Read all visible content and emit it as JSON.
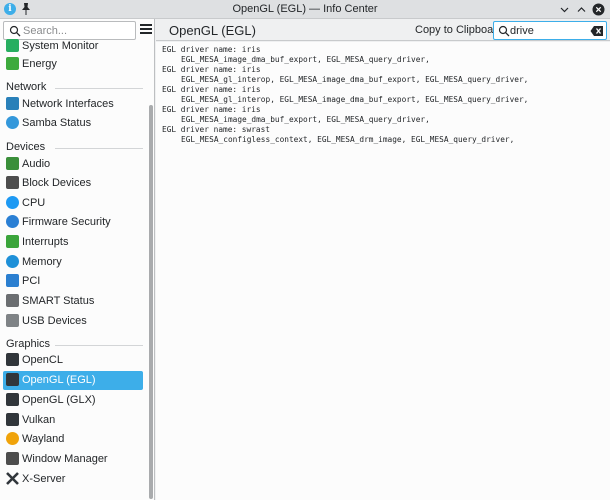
{
  "window": {
    "title": "OpenGL (EGL) — Info Center",
    "app_icon_glyph": "i"
  },
  "sidebar": {
    "search_placeholder": "Search...",
    "partial_item": {
      "label": "System Monitor",
      "icon": "system-monitor-icon",
      "color": "#27ae60"
    },
    "items_top": [
      {
        "label": "Energy",
        "icon": "energy-icon",
        "color": "#3daa3d"
      }
    ],
    "sections": [
      {
        "title": "Network",
        "items": [
          {
            "label": "Network Interfaces",
            "icon": "network-interfaces-icon",
            "color": "#2980b9"
          },
          {
            "label": "Samba Status",
            "icon": "samba-icon",
            "color": "#3498db"
          }
        ]
      },
      {
        "title": "Devices",
        "items": [
          {
            "label": "Audio",
            "icon": "audio-icon",
            "color": "#3a8f3a"
          },
          {
            "label": "Block Devices",
            "icon": "block-devices-icon",
            "color": "#4d4d4d"
          },
          {
            "label": "CPU",
            "icon": "cpu-icon",
            "color": "#1d99f3"
          },
          {
            "label": "Firmware Security",
            "icon": "firmware-security-icon",
            "color": "#2a7fd4"
          },
          {
            "label": "Interrupts",
            "icon": "interrupts-icon",
            "color": "#3ba53b"
          },
          {
            "label": "Memory",
            "icon": "memory-icon",
            "color": "#1e90d8"
          },
          {
            "label": "PCI",
            "icon": "pci-icon",
            "color": "#2b7fd0"
          },
          {
            "label": "SMART Status",
            "icon": "smart-status-icon",
            "color": "#6b6e71"
          },
          {
            "label": "USB Devices",
            "icon": "usb-devices-icon",
            "color": "#7f8386"
          }
        ]
      },
      {
        "title": "Graphics",
        "items": [
          {
            "label": "OpenCL",
            "icon": "opencl-icon",
            "color": "#31363b"
          },
          {
            "label": "OpenGL (EGL)",
            "icon": "opengl-egl-icon",
            "color": "#31363b",
            "selected": true
          },
          {
            "label": "OpenGL (GLX)",
            "icon": "opengl-glx-icon",
            "color": "#31363b"
          },
          {
            "label": "Vulkan",
            "icon": "vulkan-icon",
            "color": "#31363b"
          },
          {
            "label": "Wayland",
            "icon": "wayland-icon",
            "color": "#f0a30a"
          },
          {
            "label": "Window Manager",
            "icon": "window-manager-icon",
            "color": "#4d4d4d"
          },
          {
            "label": "X-Server",
            "icon": "x-server-icon",
            "color": "#31363b"
          }
        ]
      }
    ]
  },
  "header": {
    "page_title": "OpenGL (EGL)",
    "copy_label": "Copy to Clipboard",
    "filter_value": "drive"
  },
  "content": {
    "lines": [
      {
        "text": "EGL driver name: iris",
        "indent": false
      },
      {
        "text": "EGL_MESA_image_dma_buf_export, EGL_MESA_query_driver,",
        "indent": true
      },
      {
        "text": "EGL driver name: iris",
        "indent": false
      },
      {
        "text": "EGL_MESA_gl_interop, EGL_MESA_image_dma_buf_export, EGL_MESA_query_driver,",
        "indent": true
      },
      {
        "text": "EGL driver name: iris",
        "indent": false
      },
      {
        "text": "EGL_MESA_gl_interop, EGL_MESA_image_dma_buf_export, EGL_MESA_query_driver,",
        "indent": true
      },
      {
        "text": "EGL driver name: iris",
        "indent": false
      },
      {
        "text": "EGL_MESA_image_dma_buf_export, EGL_MESA_query_driver,",
        "indent": true
      },
      {
        "text": "EGL driver name: swrast",
        "indent": false
      },
      {
        "text": "EGL_MESA_configless_context, EGL_MESA_drm_image, EGL_MESA_query_driver,",
        "indent": true
      }
    ]
  },
  "colors": {
    "accent": "#3daee9",
    "window_bg": "#eff0f1",
    "view_bg": "#fcfcfc"
  }
}
